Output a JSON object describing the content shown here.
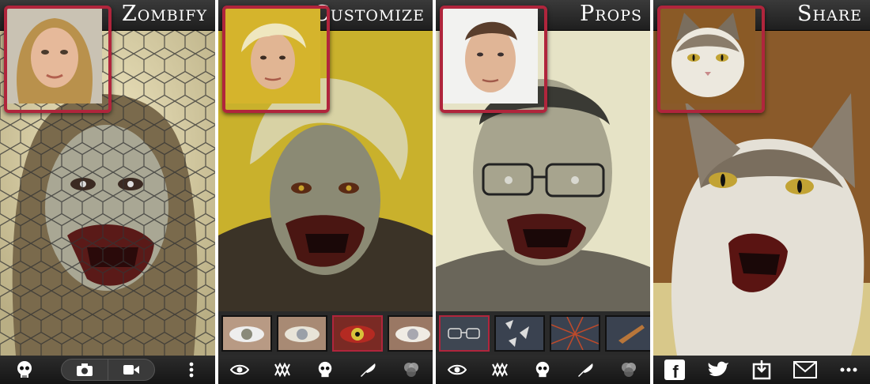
{
  "panels": [
    {
      "title": "Zombify"
    },
    {
      "title": "Customize"
    },
    {
      "title": "Props"
    },
    {
      "title": "Share"
    }
  ],
  "colors": {
    "accent_red": "#b0253c",
    "bar_dark": "#1e1e1e"
  },
  "zombify": {
    "toolbar_icons": [
      "skull-icon",
      "camera-icon",
      "video-icon",
      "more-vertical-icon"
    ]
  },
  "customize": {
    "strip": [
      "eye-option",
      "eye-option-selected",
      "eye-option",
      "eye-option"
    ],
    "tabs": [
      "eye-icon",
      "teeth-icon",
      "skull-icon",
      "knife-icon",
      "color-blend-icon"
    ]
  },
  "props": {
    "strip": [
      "glasses-prop-selected",
      "shards-prop",
      "fence-prop",
      "blade-prop"
    ],
    "tabs": [
      "eye-icon",
      "teeth-icon",
      "skull-icon",
      "knife-icon",
      "color-blend-icon"
    ]
  },
  "share": {
    "icons": [
      "facebook-icon",
      "twitter-icon",
      "save-icon",
      "email-icon",
      "more-horizontal-icon"
    ],
    "facebook_glyph": "f"
  }
}
